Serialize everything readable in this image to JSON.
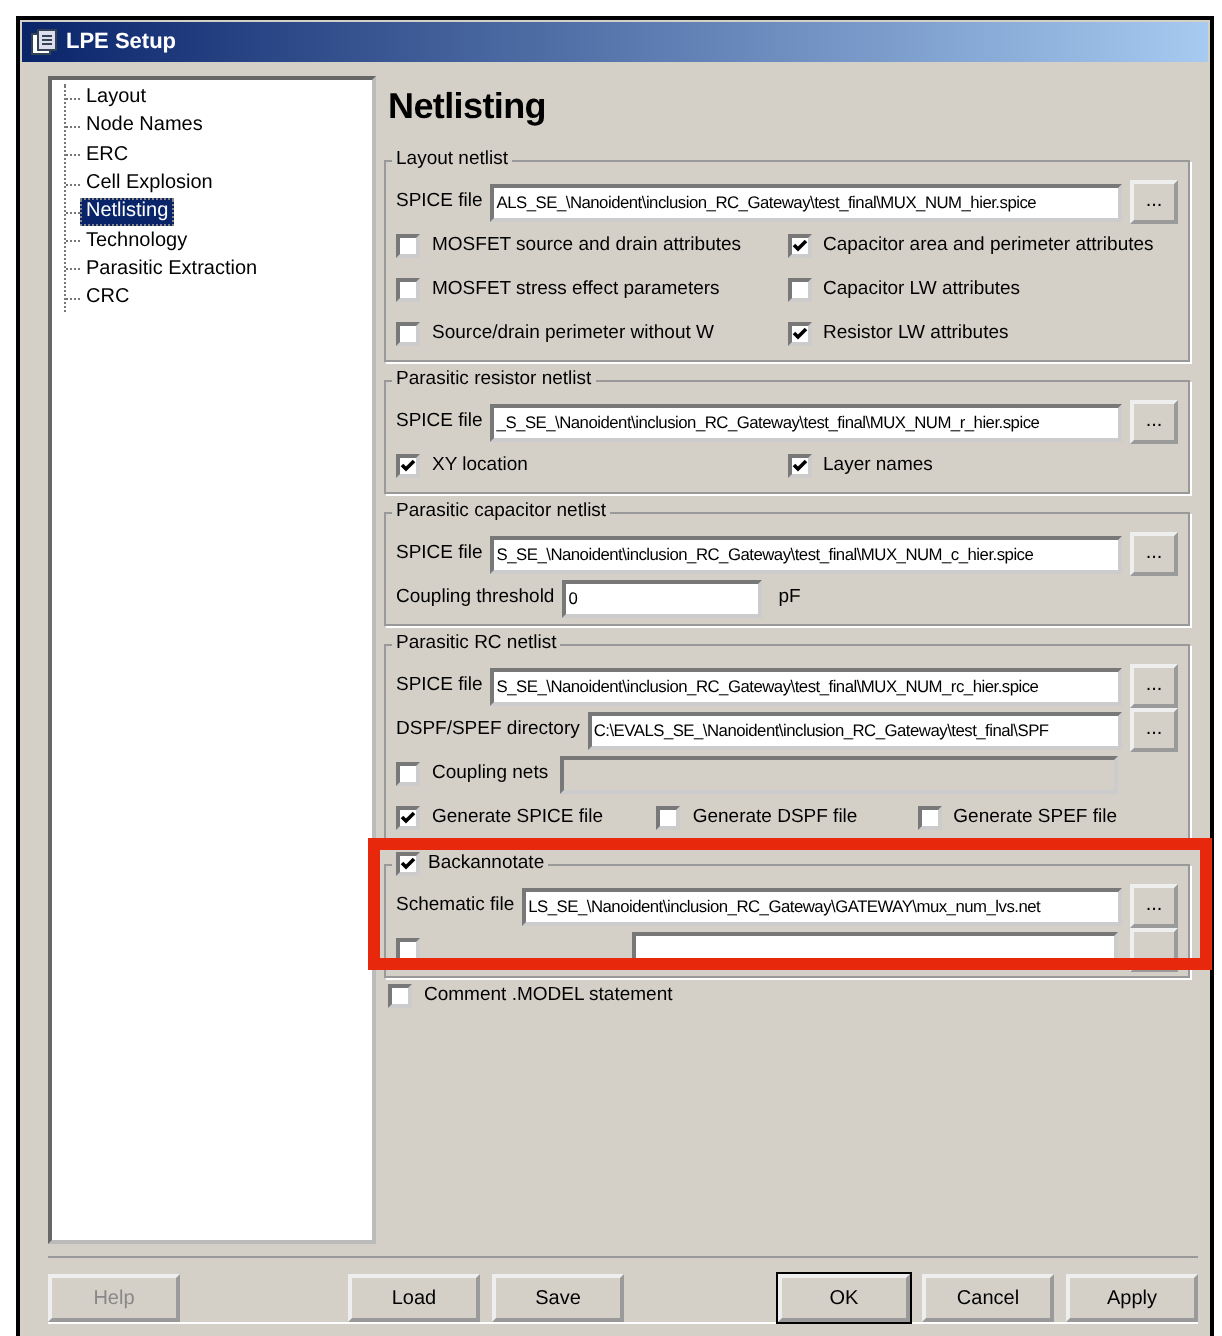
{
  "window": {
    "title": "LPE Setup"
  },
  "tree": [
    {
      "label": "Layout",
      "selected": false
    },
    {
      "label": "Node Names",
      "selected": false
    },
    {
      "label": "ERC",
      "selected": false
    },
    {
      "label": "Cell Explosion",
      "selected": false
    },
    {
      "label": "Netlisting",
      "selected": true
    },
    {
      "label": "Technology",
      "selected": false
    },
    {
      "label": "Parasitic Extraction",
      "selected": false
    },
    {
      "label": "CRC",
      "selected": false
    }
  ],
  "heading": "Netlisting",
  "groups": [
    {
      "title": "Layout netlist",
      "highlighted": false,
      "rows": [
        {
          "kind": "file",
          "label": "SPICE file",
          "value": "ALS_SE_\\Nanoident\\inclusion_RC_Gateway\\test_final\\MUX_NUM_hier.spice",
          "button": "..."
        },
        {
          "kind": "checks",
          "items": [
            {
              "label": "MOSFET source and drain attributes",
              "checked": false
            },
            {
              "label": "Capacitor area and perimeter attributes",
              "checked": true
            }
          ]
        },
        {
          "kind": "checks",
          "items": [
            {
              "label": "MOSFET stress effect parameters",
              "checked": false
            },
            {
              "label": "Capacitor LW attributes",
              "checked": false
            }
          ]
        },
        {
          "kind": "checks",
          "items": [
            {
              "label": "Source/drain perimeter without W",
              "checked": false
            },
            {
              "label": "Resistor LW attributes",
              "checked": true
            }
          ]
        }
      ]
    },
    {
      "title": "Parasitic resistor netlist",
      "highlighted": false,
      "rows": [
        {
          "kind": "file",
          "label": "SPICE file",
          "value": "_S_SE_\\Nanoident\\inclusion_RC_Gateway\\test_final\\MUX_NUM_r_hier.spice",
          "button": "..."
        },
        {
          "kind": "checks",
          "items": [
            {
              "label": "XY location",
              "checked": true
            },
            {
              "label": "Layer names",
              "checked": true
            }
          ]
        }
      ]
    },
    {
      "title": "Parasitic capacitor netlist",
      "highlighted": false,
      "rows": [
        {
          "kind": "file",
          "label": "SPICE file",
          "value": "S_SE_\\Nanoident\\inclusion_RC_Gateway\\test_final\\MUX_NUM_c_hier.spice",
          "button": "..."
        },
        {
          "kind": "unit",
          "label": "Coupling threshold",
          "value": "0",
          "unit": "pF"
        }
      ]
    },
    {
      "title": "Parasitic RC netlist",
      "highlighted": false,
      "rows": [
        {
          "kind": "file",
          "label": "SPICE file",
          "value": "S_SE_\\Nanoident\\inclusion_RC_Gateway\\test_final\\MUX_NUM_rc_hier.spice",
          "button": "..."
        },
        {
          "kind": "file",
          "label": "DSPF/SPEF directory",
          "value": "C:\\EVALS_SE_\\Nanoident\\inclusion_RC_Gateway\\test_final\\SPF",
          "button": "..."
        },
        {
          "kind": "checkfield",
          "label": "Coupling nets",
          "checked": false,
          "disabled": true
        },
        {
          "kind": "checks",
          "items": [
            {
              "label": "Generate SPICE file",
              "checked": true
            },
            {
              "label": "Generate DSPF file",
              "checked": false
            },
            {
              "label": "Generate SPEF file",
              "checked": false
            }
          ]
        }
      ]
    },
    {
      "title": "Backannotate",
      "checked": true,
      "highlighted": true,
      "rows": [
        {
          "kind": "file",
          "label": "Schematic file",
          "value": "LS_SE_\\Nanoident\\inclusion_RC_Gateway\\GATEWAY\\mux_num_lvs.net",
          "button": "..."
        },
        {
          "kind": "covered",
          "checked": false
        }
      ]
    }
  ],
  "comment": {
    "label": "Comment .MODEL statement",
    "checked": false
  },
  "buttons": [
    {
      "label": "Help",
      "disabled": true,
      "default": false
    },
    {
      "label": "Load",
      "disabled": false,
      "default": false
    },
    {
      "label": "Save",
      "disabled": false,
      "default": false
    },
    {
      "label": "OK",
      "disabled": false,
      "default": true
    },
    {
      "label": "Cancel",
      "disabled": false,
      "default": false
    },
    {
      "label": "Apply",
      "disabled": false,
      "default": false
    }
  ]
}
